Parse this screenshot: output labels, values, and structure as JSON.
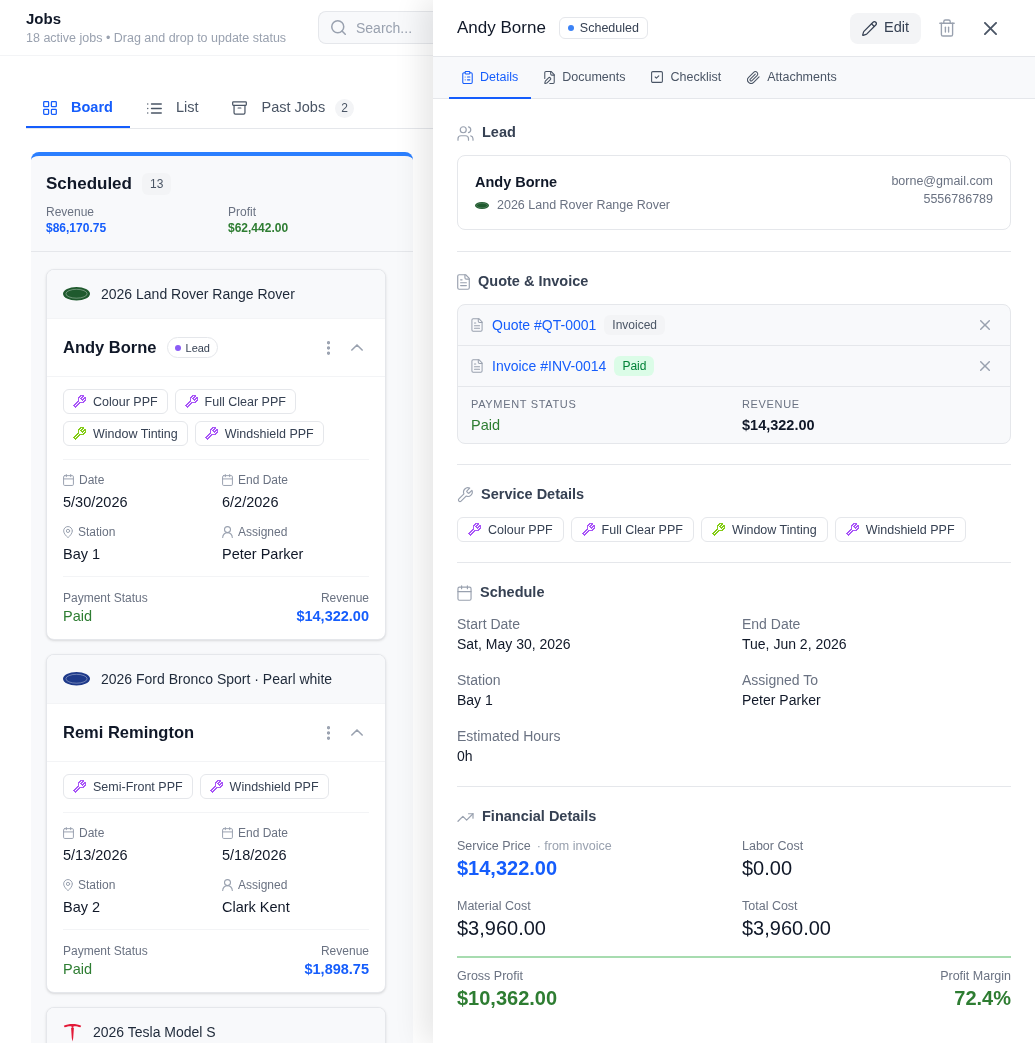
{
  "page": {
    "title": "Jobs",
    "subtitle": "18 active jobs • Drag and drop to update status",
    "search": {
      "placeholder": "Search..."
    }
  },
  "view_tabs": [
    {
      "label": "Board",
      "selected": true
    },
    {
      "label": "List",
      "selected": false
    },
    {
      "label": "Past Jobs",
      "count": "2",
      "selected": false
    }
  ],
  "column": {
    "title": "Scheduled",
    "count": "13",
    "stats": [
      {
        "label": "Revenue",
        "value": "$86,170.75",
        "kind": "revenue"
      },
      {
        "label": "Profit",
        "value": "$62,442.00",
        "kind": "profit"
      }
    ],
    "jobs": [
      {
        "vehicle": "2026 Land Rover Range Rover",
        "logo": {
          "kind": "oval",
          "color": "#1f5a2e"
        },
        "customer": "Andy Borne",
        "badge": {
          "label": "Lead",
          "color": "#8b5cf6"
        },
        "expanded": true,
        "services": [
          {
            "label": "Colour PPF",
            "color": "#a855f7"
          },
          {
            "label": "Full Clear PPF",
            "color": "#a855f7"
          },
          {
            "label": "Window Tinting",
            "color": "#84cc16"
          },
          {
            "label": "Windshield PPF",
            "color": "#a855f7"
          }
        ],
        "fields": [
          {
            "label": "Date",
            "value": "5/30/2026"
          },
          {
            "label": "End Date",
            "value": "6/2/2026"
          },
          {
            "label": "Station",
            "value": "Bay 1"
          },
          {
            "label": "Assigned",
            "value": "Peter Parker"
          }
        ],
        "payment": {
          "label": "Payment Status",
          "value": "Paid"
        },
        "revenue": {
          "label": "Revenue",
          "value": "$14,322.00"
        }
      },
      {
        "vehicle": "2026 Ford Bronco Sport · Pearl white",
        "logo": {
          "kind": "oval",
          "color": "#1e3a8a"
        },
        "customer": "Remi Remington",
        "expanded": true,
        "services": [
          {
            "label": "Semi-Front PPF",
            "color": "#a855f7"
          },
          {
            "label": "Windshield PPF",
            "color": "#a855f7"
          }
        ],
        "fields": [
          {
            "label": "Date",
            "value": "5/13/2026"
          },
          {
            "label": "End Date",
            "value": "5/18/2026"
          },
          {
            "label": "Station",
            "value": "Bay 2"
          },
          {
            "label": "Assigned",
            "value": "Clark Kent"
          }
        ],
        "payment": {
          "label": "Payment Status",
          "value": "Paid"
        },
        "revenue": {
          "label": "Revenue",
          "value": "$1,898.75"
        }
      },
      {
        "vehicle": "2026 Tesla Model S",
        "logo": {
          "kind": "t",
          "color": "#e31937"
        }
      }
    ]
  },
  "drawer": {
    "title": "Andy Borne",
    "status": {
      "label": "Scheduled",
      "color": "#3b82f6"
    },
    "edit_button": "Edit",
    "tabs": [
      {
        "label": "Details",
        "selected": true
      },
      {
        "label": "Documents",
        "selected": false
      },
      {
        "label": "Checklist",
        "selected": false
      },
      {
        "label": "Attachments",
        "selected": false
      }
    ],
    "sections": [
      {
        "kind": "lead",
        "title": "Lead",
        "name": "Andy Borne",
        "vehicle": "2026 Land Rover Range Rover",
        "logo": {
          "kind": "oval",
          "color": "#1f5a2e"
        },
        "email": "borne@gmail.com",
        "phone": "5556786789"
      },
      {
        "kind": "documents",
        "title": "Quote & Invoice",
        "documents": [
          {
            "label": "Quote #QT-0001",
            "badge": {
              "label": "Invoiced",
              "kind": "neutral"
            }
          },
          {
            "label": "Invoice #INV-0014",
            "badge": {
              "label": "Paid",
              "kind": "success"
            }
          }
        ],
        "summary": [
          {
            "label": "PAYMENT STATUS",
            "value": "Paid",
            "kind": "status"
          },
          {
            "label": "REVENUE",
            "value": "$14,322.00",
            "kind": "amount"
          }
        ]
      },
      {
        "kind": "services",
        "title": "Service Details",
        "services": [
          {
            "label": "Colour PPF",
            "color": "#a855f7"
          },
          {
            "label": "Full Clear PPF",
            "color": "#a855f7"
          },
          {
            "label": "Window Tinting",
            "color": "#84cc16"
          },
          {
            "label": "Windshield PPF",
            "color": "#a855f7"
          }
        ]
      },
      {
        "kind": "schedule",
        "title": "Schedule",
        "fields": [
          {
            "label": "Start Date",
            "value": "Sat, May 30, 2026"
          },
          {
            "label": "End Date",
            "value": "Tue, Jun 2, 2026"
          },
          {
            "label": "Station",
            "value": "Bay 1"
          },
          {
            "label": "Assigned To",
            "value": "Peter Parker"
          },
          {
            "label": "Estimated Hours",
            "value": "0h"
          }
        ]
      },
      {
        "kind": "financial",
        "title": "Financial Details",
        "metrics": [
          {
            "label": "Service Price",
            "note": "· from invoice",
            "value": "$14,322.00",
            "kind": "price"
          },
          {
            "label": "Labor Cost",
            "value": "$0.00",
            "kind": "cost"
          },
          {
            "label": "Material Cost",
            "value": "$3,960.00",
            "kind": "cost"
          },
          {
            "label": "Total Cost",
            "value": "$3,960.00",
            "kind": "cost"
          }
        ],
        "totals": [
          {
            "label": "Gross Profit",
            "value": "$10,362.00"
          },
          {
            "label": "Profit Margin",
            "value": "72.4%"
          }
        ]
      }
    ]
  }
}
